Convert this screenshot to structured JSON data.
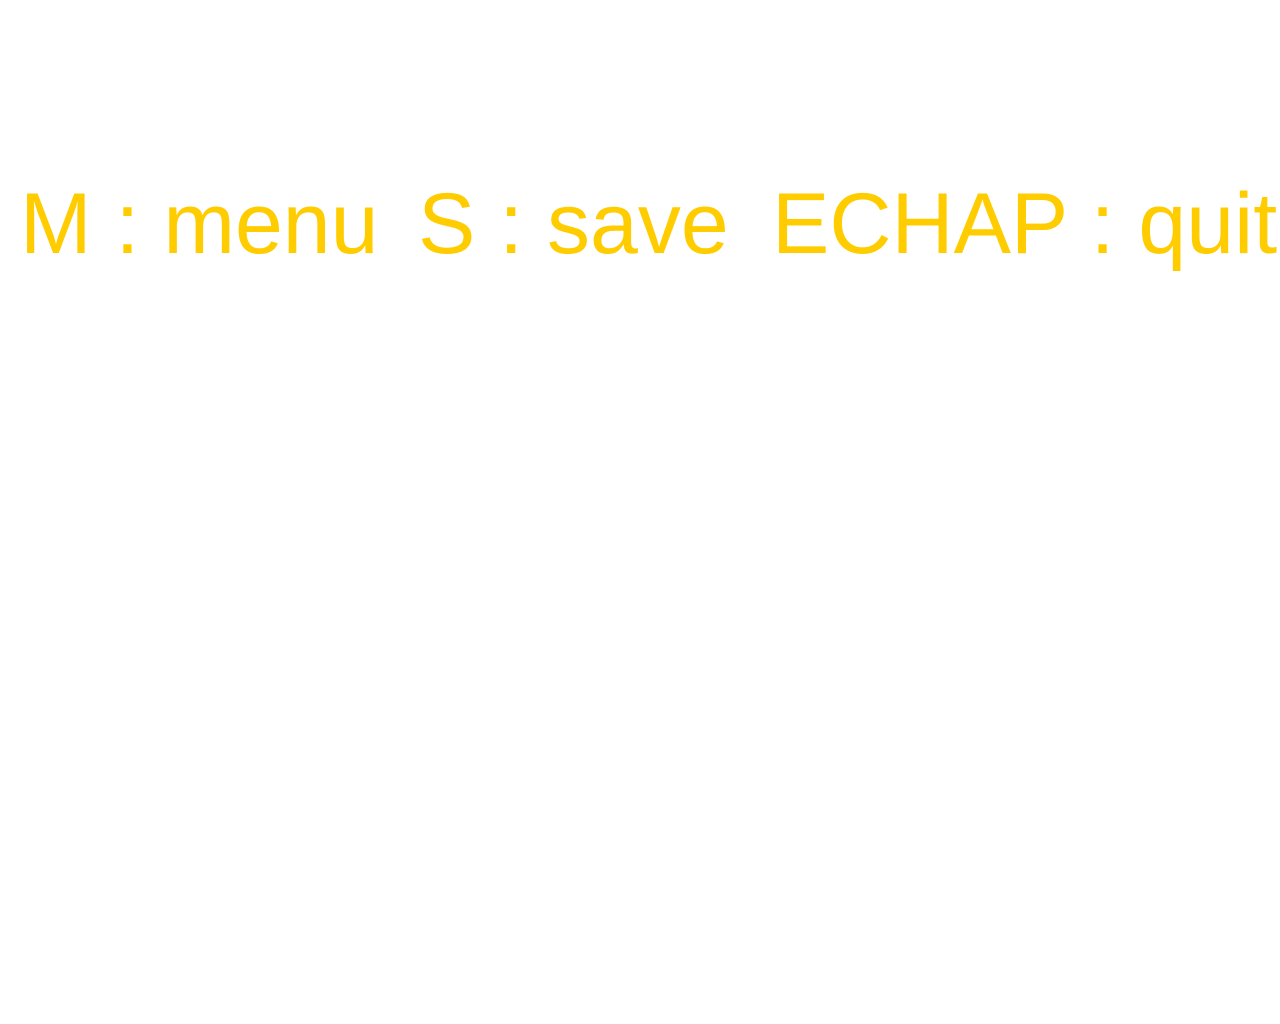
{
  "hints": {
    "menu": "M : menu",
    "save": "S : save",
    "quit": "ECHAP : quit"
  },
  "colors": {
    "background": "#ffffff",
    "hint_text": "#ffcc00"
  }
}
